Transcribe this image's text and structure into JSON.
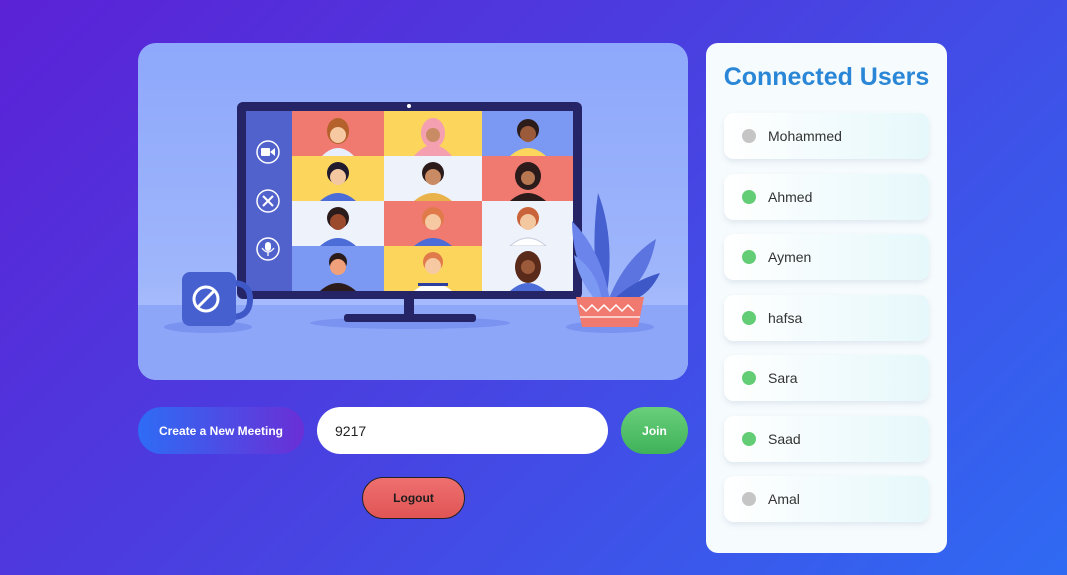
{
  "actions": {
    "create_label": "Create a New Meeting",
    "meeting_code": "9217",
    "join_label": "Join",
    "logout_label": "Logout"
  },
  "panel": {
    "title": "Connected Users",
    "users": [
      {
        "name": "Mohammed",
        "status": "offline"
      },
      {
        "name": "Ahmed",
        "status": "online"
      },
      {
        "name": "Aymen",
        "status": "online"
      },
      {
        "name": "hafsa",
        "status": "online"
      },
      {
        "name": "Sara",
        "status": "online"
      },
      {
        "name": "Saad",
        "status": "online"
      },
      {
        "name": "Amal",
        "status": "offline"
      }
    ]
  },
  "colors": {
    "accent": "#2a86d6",
    "online": "#62cd75",
    "offline": "#c5c5c5",
    "join": "#4fbf66",
    "logout": "#e45c5c"
  },
  "icons": [
    "video-camera-icon",
    "close-icon",
    "microphone-icon"
  ]
}
